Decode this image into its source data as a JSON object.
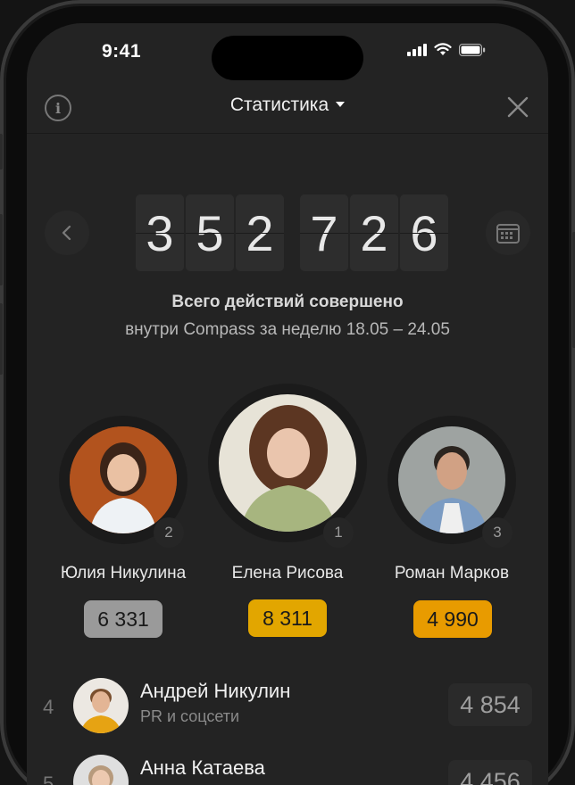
{
  "status_bar": {
    "time": "9:41"
  },
  "header": {
    "title": "Статистика",
    "info_icon": "info-icon",
    "close_icon": "close-icon"
  },
  "counter": {
    "digits": [
      "3",
      "5",
      "2",
      "7",
      "2",
      "6"
    ],
    "caption_line1": "Всего действий совершено",
    "caption_line2": "внутри Compass за неделю 18.05 – 24.05"
  },
  "podium": [
    {
      "name": "Юлия Никулина",
      "rank": "2",
      "score": "6 331",
      "pill_color": "#9a9a9a"
    },
    {
      "name": "Елена Рисова",
      "rank": "1",
      "score": "8 311",
      "pill_color": "#e2a600"
    },
    {
      "name": "Роман Марков",
      "rank": "3",
      "score": "4 990",
      "pill_color": "#e89b00"
    }
  ],
  "leaderboard": [
    {
      "rank": "4",
      "name": "Андрей Никулин",
      "department": "PR и соцсети",
      "score": "4 854"
    },
    {
      "rank": "5",
      "name": "Анна Катаева",
      "department": "",
      "score": "4 456"
    }
  ],
  "colors": {
    "background": "#232323",
    "gold": "#e2a600",
    "silver": "#9a9a9a",
    "bronze": "#e89b00"
  }
}
